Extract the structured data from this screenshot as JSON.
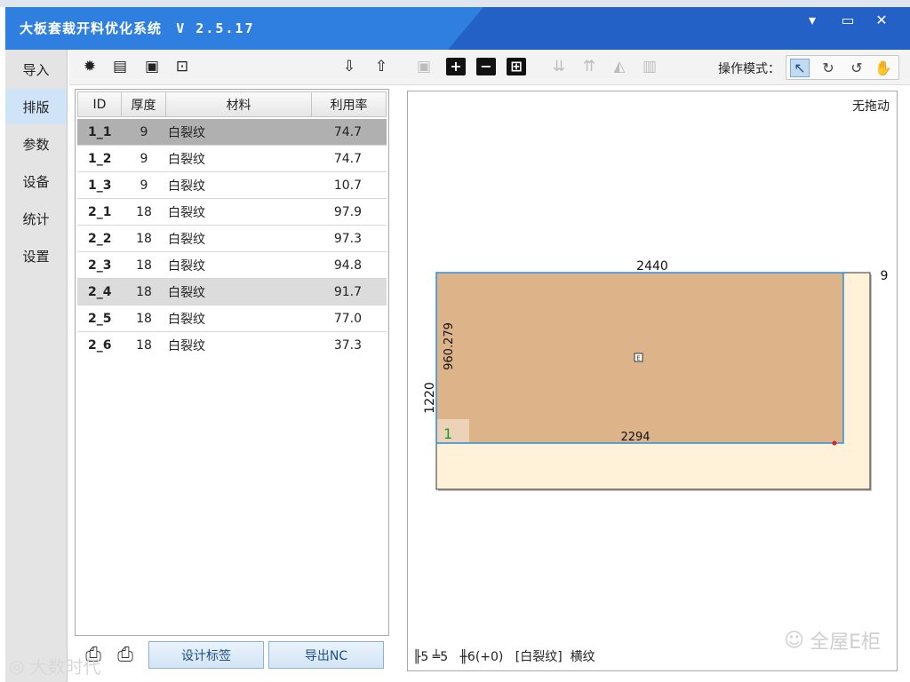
{
  "window": {
    "title": "大板套裁开料优化系统",
    "version": "V 2.5.17",
    "minimize": "▾",
    "restore": "▭",
    "close": "✕"
  },
  "nav": {
    "items": [
      {
        "label": "导入"
      },
      {
        "label": "排版"
      },
      {
        "label": "参数"
      },
      {
        "label": "设备"
      },
      {
        "label": "统计"
      },
      {
        "label": "设置"
      }
    ]
  },
  "toolbar": {
    "icons": [
      "gear-icon",
      "layers-icon",
      "image-icon",
      "search-doc-icon",
      "import-icon",
      "export-icon",
      "save-icon",
      "add-icon",
      "remove-icon",
      "add-box-icon",
      "align-bottom-icon",
      "align-top-icon",
      "chart-icon",
      "bars-icon"
    ],
    "operation_mode_label": "操作模式：",
    "modes": [
      "select-icon",
      "rotate-cw-icon",
      "rotate-ccw-icon",
      "hand-icon"
    ]
  },
  "table": {
    "headers": [
      "ID",
      "厚度",
      "材料",
      "利用率"
    ],
    "rows": [
      {
        "id": "1_1",
        "thickness": "9",
        "material": "白裂纹",
        "utilization": "74.7"
      },
      {
        "id": "1_2",
        "thickness": "9",
        "material": "白裂纹",
        "utilization": "74.7"
      },
      {
        "id": "1_3",
        "thickness": "9",
        "material": "白裂纹",
        "utilization": "10.7"
      },
      {
        "id": "2_1",
        "thickness": "18",
        "material": "白裂纹",
        "utilization": "97.9"
      },
      {
        "id": "2_2",
        "thickness": "18",
        "material": "白裂纹",
        "utilization": "97.3"
      },
      {
        "id": "2_3",
        "thickness": "18",
        "material": "白裂纹",
        "utilization": "94.8"
      },
      {
        "id": "2_4",
        "thickness": "18",
        "material": "白裂纹",
        "utilization": "91.7"
      },
      {
        "id": "2_5",
        "thickness": "18",
        "material": "白裂纹",
        "utilization": "77.0"
      },
      {
        "id": "2_6",
        "thickness": "18",
        "material": "白裂纹",
        "utilization": "37.3"
      }
    ]
  },
  "bottom": {
    "design_label_button": "设计标签",
    "export_nc_button": "导出NC"
  },
  "canvas": {
    "mode_text": "无拖动",
    "board_width": "2440",
    "board_height": "1220",
    "thickness_label": "9",
    "part_height": "960.279",
    "part_width": "2294",
    "part_number": "1",
    "part_marker": "E",
    "status": {
      "a": "╟5",
      "b": "╧5",
      "c": "╫6(+0)",
      "material": "[白裂纹]",
      "grain": "横纹"
    }
  },
  "watermark": {
    "right": "全屋E柜",
    "left": "大数时代"
  },
  "colors": {
    "titlebar": "#2f7fe0",
    "board": "#fff2d9",
    "part": "#ddb38a",
    "part_border": "#2b8fe0"
  }
}
